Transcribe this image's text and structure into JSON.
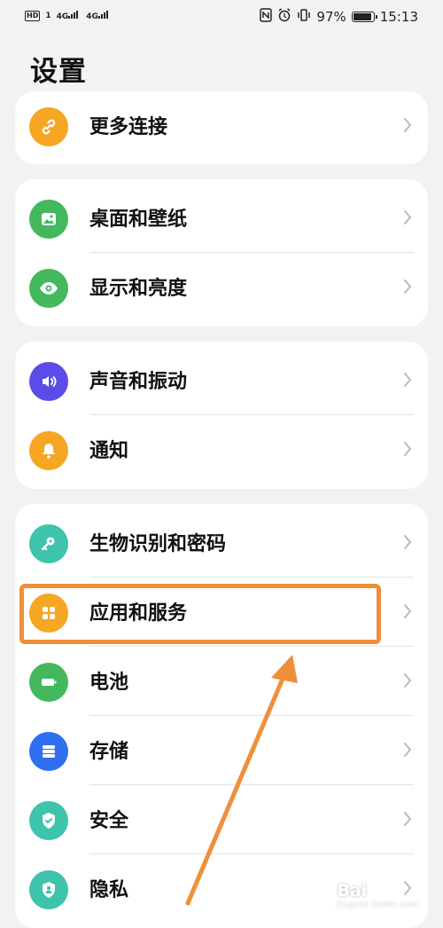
{
  "status_bar": {
    "left_hd": "HD",
    "left_sim1": "1",
    "left_net1": "4G",
    "left_net2": "4G",
    "battery_percent_text": "97%",
    "battery_level": 0.97,
    "time": "15:13"
  },
  "page": {
    "title": "设置"
  },
  "groups": [
    {
      "items": [
        {
          "label": "更多连接",
          "icon": "link-icon",
          "color": "#f5a623"
        }
      ]
    },
    {
      "items": [
        {
          "label": "桌面和壁纸",
          "icon": "image-icon",
          "color": "#43b85c"
        },
        {
          "label": "显示和亮度",
          "icon": "eye-icon",
          "color": "#43b85c"
        }
      ]
    },
    {
      "items": [
        {
          "label": "声音和振动",
          "icon": "speaker-icon",
          "color": "#5b4ce8"
        },
        {
          "label": "通知",
          "icon": "bell-icon",
          "color": "#f5a623"
        }
      ]
    },
    {
      "items": [
        {
          "label": "生物识别和密码",
          "icon": "key-icon",
          "color": "#3ec3ad"
        },
        {
          "label": "应用和服务",
          "icon": "apps-icon",
          "color": "#f5a623"
        },
        {
          "label": "电池",
          "icon": "battery-icon",
          "color": "#43b85c"
        },
        {
          "label": "存储",
          "icon": "storage-icon",
          "color": "#2f6ef0"
        },
        {
          "label": "安全",
          "icon": "shield-icon",
          "color": "#3ec3ad"
        },
        {
          "label": "隐私",
          "icon": "privacy-icon",
          "color": "#3ec3ad"
        }
      ]
    }
  ],
  "annotation": {
    "highlight_color": "#f08f3a",
    "highlighted_item": "应用和服务"
  },
  "watermark": {
    "text": "Bai",
    "sub": "jingyan.baidu.com"
  }
}
